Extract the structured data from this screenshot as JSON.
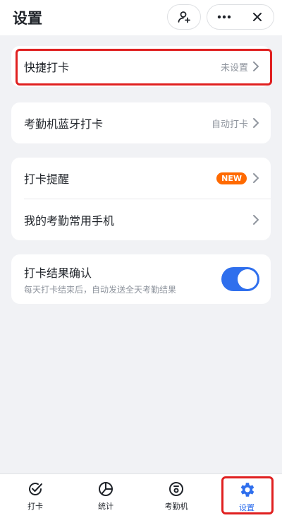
{
  "header": {
    "title": "设置"
  },
  "rows": {
    "quick_checkin": {
      "label": "快捷打卡",
      "value": "未设置"
    },
    "bluetooth": {
      "label": "考勤机蓝牙打卡",
      "value": "自动打卡"
    },
    "reminder": {
      "label": "打卡提醒",
      "badge": "NEW"
    },
    "phone": {
      "label": "我的考勤常用手机"
    },
    "confirm": {
      "label": "打卡结果确认",
      "sub": "每天打卡结束后，自动发送全天考勤结果",
      "enabled": true
    }
  },
  "tabs": [
    {
      "label": "打卡",
      "icon": "checkmark-icon"
    },
    {
      "label": "统计",
      "icon": "pie-chart-icon"
    },
    {
      "label": "考勤机",
      "icon": "attendance-machine-icon"
    },
    {
      "label": "设置",
      "icon": "gear-icon"
    }
  ],
  "colors": {
    "accent": "#2f6fed",
    "badge": "#ff6a00",
    "highlight": "#e02020"
  }
}
